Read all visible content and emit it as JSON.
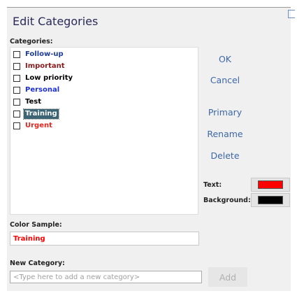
{
  "dialog": {
    "title": "Edit Categories"
  },
  "categories": {
    "label": "Categories:",
    "items": [
      {
        "name": "Follow-up",
        "color": "#1f3d9c",
        "checked": false,
        "selected": false
      },
      {
        "name": "Important",
        "color": "#8b1a1a",
        "checked": false,
        "selected": false
      },
      {
        "name": "Low priority",
        "color": "#000000",
        "checked": false,
        "selected": false
      },
      {
        "name": "Personal",
        "color": "#1c2fd8",
        "checked": false,
        "selected": false
      },
      {
        "name": "Test",
        "color": "#000000",
        "checked": false,
        "selected": false
      },
      {
        "name": "Training",
        "color": "#ff0000",
        "checked": false,
        "selected": true
      },
      {
        "name": "Urgent",
        "color": "#e8261f",
        "checked": false,
        "selected": false
      }
    ]
  },
  "buttons": {
    "ok": "OK",
    "cancel": "Cancel",
    "primary": "Primary",
    "rename": "Rename",
    "delete": "Delete",
    "add": "Add"
  },
  "colors": {
    "text_label": "Text:",
    "text_color": "#ff0000",
    "background_label": "Background:",
    "background_color": "#000000"
  },
  "color_sample": {
    "label": "Color Sample:",
    "text": "Training",
    "color": "#ff0000"
  },
  "new_category": {
    "label": "New Category:",
    "value": "",
    "placeholder": "<Type here to add a new category>"
  }
}
